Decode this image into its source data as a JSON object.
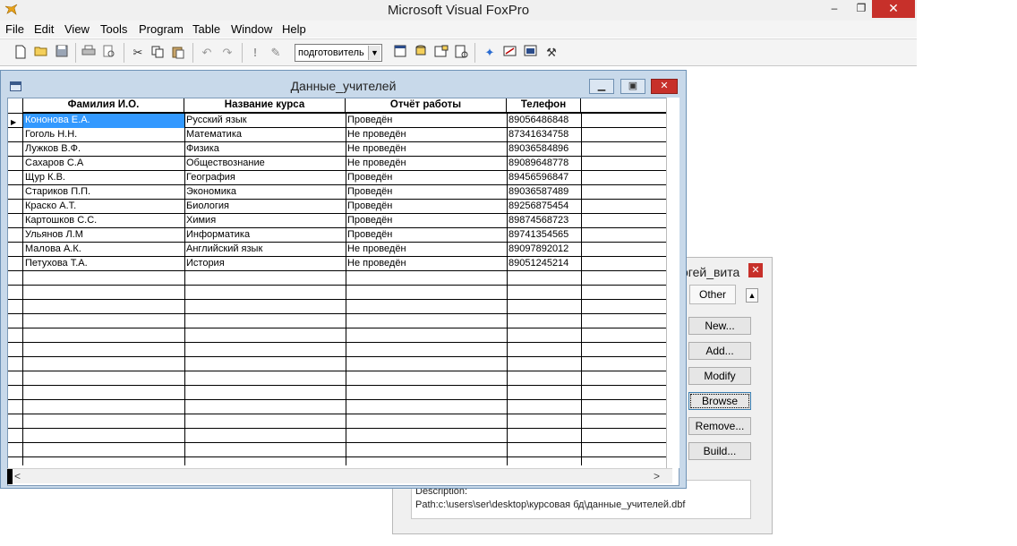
{
  "app": {
    "title": "Microsoft Visual FoxPro",
    "icon": "foxpro-fox-icon",
    "window_controls": {
      "minimize": "–",
      "restore": "❐",
      "close": "✕"
    }
  },
  "menu": [
    "File",
    "Edit",
    "View",
    "Tools",
    "Program",
    "Table",
    "Window",
    "Help"
  ],
  "toolbar": {
    "combo_value": "подготовитель"
  },
  "browse": {
    "title": "Данные_учителей",
    "columns": [
      "Фамилия И.О.",
      "Название курса",
      "Отчёт работы",
      "Телефон"
    ],
    "rows": [
      [
        "Кононова Е.А.",
        "Русский язык",
        "Проведён",
        "89056486848"
      ],
      [
        "Гоголь Н.Н.",
        "Математика",
        "Не проведён",
        "87341634758"
      ],
      [
        "Лужков В.Ф.",
        "Физика",
        "Не проведён",
        "89036584896"
      ],
      [
        "Сахаров С.А",
        "Обществознание",
        "Не проведён",
        "89089648778"
      ],
      [
        "Щур К.В.",
        "География",
        "Проведён",
        "89456596847"
      ],
      [
        "Стариков П.П.",
        "Экономика",
        "Проведён",
        "89036587489"
      ],
      [
        "Краско А.Т.",
        "Биология",
        "Проведён",
        "89256875454"
      ],
      [
        "Картошков С.С.",
        "Химия",
        "Проведён",
        "89874568723"
      ],
      [
        "Ульянов Л.М",
        "Информатика",
        "Проведён",
        "89741354565"
      ],
      [
        "Малова А.К.",
        "Английский язык",
        "Не проведён",
        "89097892012"
      ],
      [
        "Петухова Т.А.",
        "История",
        "Не проведён",
        "89051245214"
      ]
    ],
    "selected_row": 0,
    "scroll_left": "<",
    "scroll_right": ">"
  },
  "project_manager": {
    "title": "огей_вита",
    "tab_other": "Other",
    "up_arrow": "▲",
    "buttons": [
      "New...",
      "Add...",
      "Modify",
      "Browse",
      "Remove...",
      "Build..."
    ],
    "focused_button": "Browse",
    "description_label": "Description:",
    "path": "Path:c:\\users\\ser\\desktop\\курсовая бд\\данные_учителей.dbf"
  },
  "colors": {
    "selection": "#3399ff",
    "browse_frame": "#c8d9ea",
    "close_red": "#c7302a"
  }
}
